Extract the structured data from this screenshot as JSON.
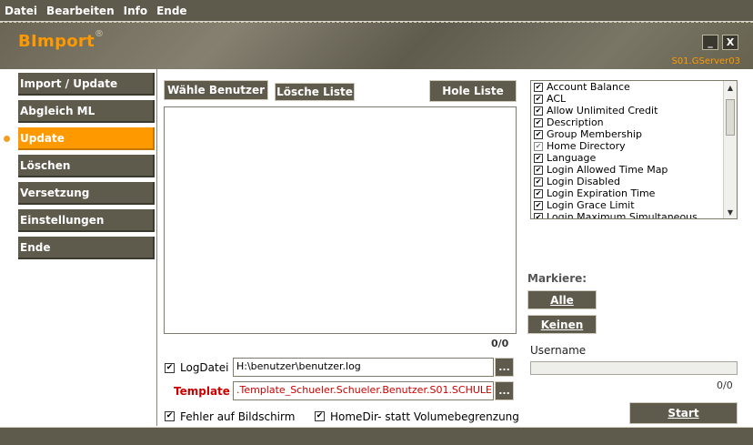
{
  "menu": [
    "Datei",
    "Bearbeiten",
    "Info",
    "Ende"
  ],
  "header": {
    "brand": "BImport",
    "brand_mark": "®",
    "minimize_label": "_",
    "close_label": "X",
    "server": "S01.GServer03"
  },
  "sidebar": {
    "items": [
      {
        "label": "Import / Update"
      },
      {
        "label": "Abgleich ML"
      },
      {
        "label": "Update"
      },
      {
        "label": "Löschen"
      },
      {
        "label": "Versetzung"
      },
      {
        "label": "Einstellungen"
      },
      {
        "label": "Ende"
      }
    ],
    "active_index": 2
  },
  "toolbar": {
    "select_users_label": "Wähle Benutzer",
    "clear_list_label": "Lösche Liste",
    "fetch_list_label": "Hole Liste"
  },
  "list": {
    "count": "0/0"
  },
  "log": {
    "checked": true,
    "label": "LogDatei",
    "path": "H:\\benutzer\\benutzer.log",
    "browse": "..."
  },
  "template": {
    "label": "Template",
    "value": ".Template_Schueler.Schueler.Benutzer.S01.SCHULE",
    "browse": "..."
  },
  "options": {
    "errors_on_screen": {
      "checked": true,
      "label": "Fehler auf Bildschirm"
    },
    "homedir_instead_volume": {
      "checked": true,
      "label": "HomeDir- statt Volumebegrenzung"
    }
  },
  "attributes": [
    {
      "label": "Account Balance",
      "checked": true,
      "dim": false
    },
    {
      "label": "ACL",
      "checked": true,
      "dim": false
    },
    {
      "label": "Allow Unlimited Credit",
      "checked": true,
      "dim": false
    },
    {
      "label": "Description",
      "checked": true,
      "dim": false
    },
    {
      "label": "Group Membership",
      "checked": true,
      "dim": false
    },
    {
      "label": "Home Directory",
      "checked": true,
      "dim": true
    },
    {
      "label": "Language",
      "checked": true,
      "dim": false
    },
    {
      "label": "Login Allowed Time Map",
      "checked": true,
      "dim": false
    },
    {
      "label": "Login Disabled",
      "checked": true,
      "dim": false
    },
    {
      "label": "Login Expiration Time",
      "checked": true,
      "dim": false
    },
    {
      "label": "Login Grace Limit",
      "checked": true,
      "dim": false
    },
    {
      "label": "Login Maximum Simultaneous",
      "checked": true,
      "dim": false
    }
  ],
  "mark": {
    "heading": "Markiere:",
    "all_label": "Alle",
    "none_label": "Keinen"
  },
  "status": {
    "username_label": "Username",
    "progress": 0,
    "count": "0/0"
  },
  "start_label": "Start"
}
